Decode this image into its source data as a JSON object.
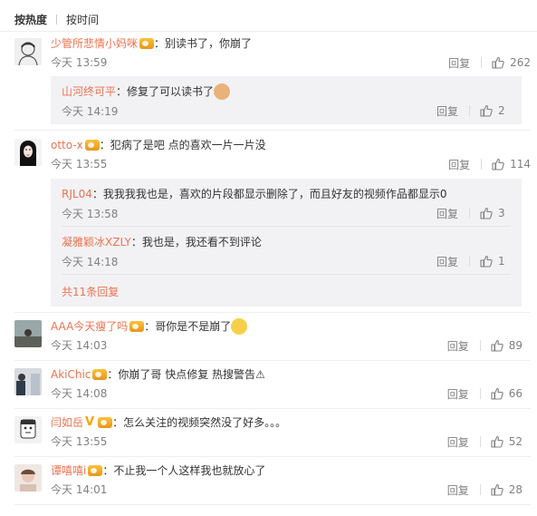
{
  "sort": {
    "hot": "按热度",
    "time": "按时间"
  },
  "reply_label": "回复",
  "comments": [
    {
      "name": "少管所悲情小妈咪",
      "text": "：别读书了，你崩了",
      "time": "今天 13:59",
      "likes": "262",
      "subs": [
        {
          "name": "山河终可平",
          "text": "：修复了可以读书了",
          "time": "今天 14:19",
          "likes": "2"
        }
      ]
    },
    {
      "name": "otto-x",
      "text": "：犯病了是吧 点的喜欢一片一片没",
      "time": "今天 13:55",
      "likes": "114",
      "subs": [
        {
          "name": "RJL04",
          "text": "：我我我我也是，喜欢的片段都显示删除了，而且好友的视频作品都显示0",
          "time": "今天 13:58",
          "likes": "3"
        },
        {
          "name": "凝雅颖冰XZLY",
          "text": "：我也是，我还看不到评论",
          "time": "今天 14:18",
          "likes": "1"
        }
      ],
      "more": "共11条回复"
    },
    {
      "name": "AAA今天瘦了吗",
      "text": "：哥你是不是崩了",
      "time": "今天 14:03",
      "likes": "89"
    },
    {
      "name": "AkiChic",
      "text": "：你崩了哥  快点修复  热搜警告⚠",
      "time": "今天 14:08",
      "likes": "66"
    },
    {
      "name": "闫如岳",
      "text": "：怎么关注的视频突然没了好多。。。",
      "time": "今天 13:55",
      "likes": "52"
    },
    {
      "name": "谭嘻嘻i",
      "text": "：不止我一个人这样我也就放心了",
      "time": "今天 14:01",
      "likes": "28"
    }
  ]
}
